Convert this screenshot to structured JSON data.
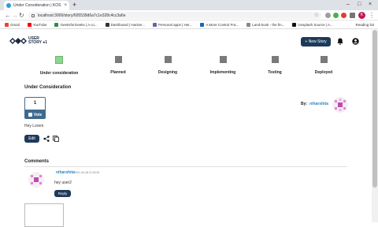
{
  "browser": {
    "tab_title": "Under Consideration | KOS User",
    "tab_close": "×",
    "new_tab": "+",
    "url": "localhost:3000/story/605539d6a7c1e328c4cc3a6e",
    "profile_initial": "K",
    "bookmarks": [
      {
        "label": "Gmail",
        "color": "#ea4335"
      },
      {
        "label": "YouTube",
        "color": "#ff0000"
      },
      {
        "label": "GeeksforGeeks | A co...",
        "color": "#2f8d46"
      },
      {
        "label": "Dashboard | Hacker...",
        "color": "#333333"
      },
      {
        "label": "Personal apps | Her...",
        "color": "#6762a6"
      },
      {
        "label": "A More Control Fra...",
        "color": "#1565c0"
      },
      {
        "label": "Land-book - the fin...",
        "color": "#888888"
      },
      {
        "label": "Unsplash Source | A...",
        "color": "#111111"
      }
    ],
    "reading_list": "Reading list"
  },
  "app": {
    "logo_line1": "USER",
    "logo_line2": "STORY ●1",
    "new_story_label": "+ New Story",
    "stages": [
      {
        "label": "Under consideration",
        "active": true
      },
      {
        "label": "Planned",
        "active": false
      },
      {
        "label": "Designing",
        "active": false
      },
      {
        "label": "Implementing",
        "active": false
      },
      {
        "label": "Testing",
        "active": false
      },
      {
        "label": "Deployed",
        "active": false
      }
    ],
    "story": {
      "title": "Under Consideration",
      "vote_count": "1",
      "vote_label": "Vote",
      "by_label": "By:",
      "author": "niharshita",
      "text": "Hey Lorem",
      "edit_label": "Edit"
    },
    "comments": {
      "title": "Comments",
      "items": [
        {
          "user": "niharshita",
          "time": "2021-04-18 11:15:30",
          "text": "hey user2",
          "reply_label": "Reply"
        }
      ]
    }
  },
  "colors": {
    "primary": "#1e3a5a",
    "vote": "#3e6a8e",
    "link": "#2e86c1",
    "active_stage": "#8fd48f",
    "inactive_stage": "#7a7a7a"
  }
}
